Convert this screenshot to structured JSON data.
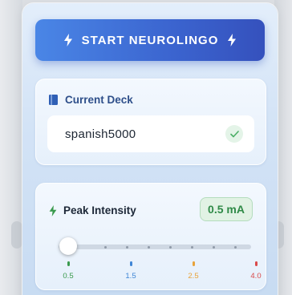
{
  "start_button": {
    "label": "START NEUROLINGO",
    "icon": "lightning-bolt-icon"
  },
  "deck": {
    "title": "Current Deck",
    "icon": "book-icon",
    "value": "spanish5000",
    "status_icon": "check-icon"
  },
  "intensity": {
    "title": "Peak Intensity",
    "icon": "lightning-bolt-icon",
    "value_display": "0.5 mA",
    "value": 0.5,
    "min": 0.5,
    "max": 4.0,
    "labels": [
      {
        "text": "0.5",
        "color": "#3a9a4e"
      },
      {
        "text": "1.5",
        "color": "#3f86d6"
      },
      {
        "text": "2.5",
        "color": "#e8a33a"
      },
      {
        "text": "4.0",
        "color": "#d94a4a"
      }
    ]
  },
  "colors": {
    "button_gradient_start": "#4a86e6",
    "button_gradient_end": "#3551bd",
    "deck_title": "#2e4f8a",
    "badge_green": "#2f8a47"
  }
}
